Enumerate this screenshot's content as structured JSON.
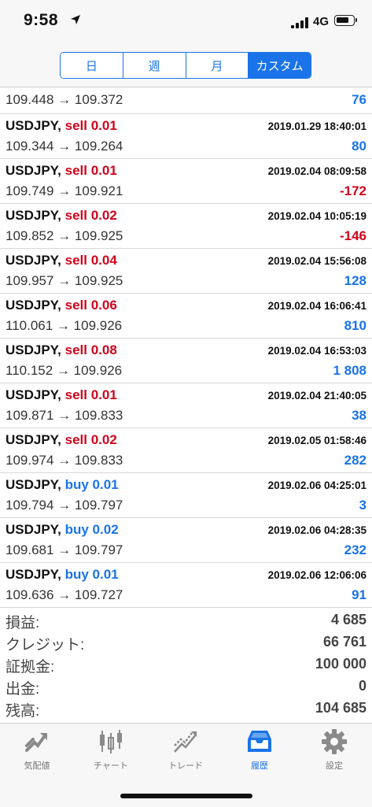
{
  "status": {
    "time": "9:58",
    "network": "4G"
  },
  "period_tabs": [
    {
      "label": "日",
      "active": false
    },
    {
      "label": "週",
      "active": false
    },
    {
      "label": "月",
      "active": false
    },
    {
      "label": "カスタム",
      "active": true
    }
  ],
  "arrow": "→",
  "first_row": {
    "open": "109.448",
    "close": "109.372",
    "profit": "76"
  },
  "trades": [
    {
      "symbol": "USDJPY,",
      "side": "sell 0.01",
      "date": "2019.01.29 18:40:01",
      "open": "109.344",
      "close": "109.264",
      "profit": "80",
      "profit_sign": "pos"
    },
    {
      "symbol": "USDJPY,",
      "side": "sell 0.01",
      "date": "2019.02.04 08:09:58",
      "open": "109.749",
      "close": "109.921",
      "profit": "-172",
      "profit_sign": "neg"
    },
    {
      "symbol": "USDJPY,",
      "side": "sell 0.02",
      "date": "2019.02.04 10:05:19",
      "open": "109.852",
      "close": "109.925",
      "profit": "-146",
      "profit_sign": "neg"
    },
    {
      "symbol": "USDJPY,",
      "side": "sell 0.04",
      "date": "2019.02.04 15:56:08",
      "open": "109.957",
      "close": "109.925",
      "profit": "128",
      "profit_sign": "pos"
    },
    {
      "symbol": "USDJPY,",
      "side": "sell 0.06",
      "date": "2019.02.04 16:06:41",
      "open": "110.061",
      "close": "109.926",
      "profit": "810",
      "profit_sign": "pos"
    },
    {
      "symbol": "USDJPY,",
      "side": "sell 0.08",
      "date": "2019.02.04 16:53:03",
      "open": "110.152",
      "close": "109.926",
      "profit": "1 808",
      "profit_sign": "pos"
    },
    {
      "symbol": "USDJPY,",
      "side": "sell 0.01",
      "date": "2019.02.04 21:40:05",
      "open": "109.871",
      "close": "109.833",
      "profit": "38",
      "profit_sign": "pos"
    },
    {
      "symbol": "USDJPY,",
      "side": "sell 0.02",
      "date": "2019.02.05 01:58:46",
      "open": "109.974",
      "close": "109.833",
      "profit": "282",
      "profit_sign": "pos"
    },
    {
      "symbol": "USDJPY,",
      "side": "buy 0.01",
      "date": "2019.02.06 04:25:01",
      "open": "109.794",
      "close": "109.797",
      "profit": "3",
      "profit_sign": "pos"
    },
    {
      "symbol": "USDJPY,",
      "side": "buy 0.02",
      "date": "2019.02.06 04:28:35",
      "open": "109.681",
      "close": "109.797",
      "profit": "232",
      "profit_sign": "pos"
    },
    {
      "symbol": "USDJPY,",
      "side": "buy 0.01",
      "date": "2019.02.06 12:06:06",
      "open": "109.636",
      "close": "109.727",
      "profit": "91",
      "profit_sign": "pos"
    }
  ],
  "summary": [
    {
      "label": "損益:",
      "value": "4 685"
    },
    {
      "label": "クレジット:",
      "value": "66 761"
    },
    {
      "label": "証拠金:",
      "value": "100 000"
    },
    {
      "label": "出金:",
      "value": "0"
    },
    {
      "label": "残高:",
      "value": "104 685"
    }
  ],
  "tabbar": [
    {
      "label": "気配値",
      "icon": "quotes-icon",
      "active": false
    },
    {
      "label": "チャート",
      "icon": "chart-icon",
      "active": false
    },
    {
      "label": "トレード",
      "icon": "trade-icon",
      "active": false
    },
    {
      "label": "履歴",
      "icon": "history-icon",
      "active": true
    },
    {
      "label": "設定",
      "icon": "settings-icon",
      "active": false
    }
  ],
  "colors": {
    "accent": "#1a73e8",
    "loss": "#d0021b",
    "profit": "#1a73e8"
  }
}
